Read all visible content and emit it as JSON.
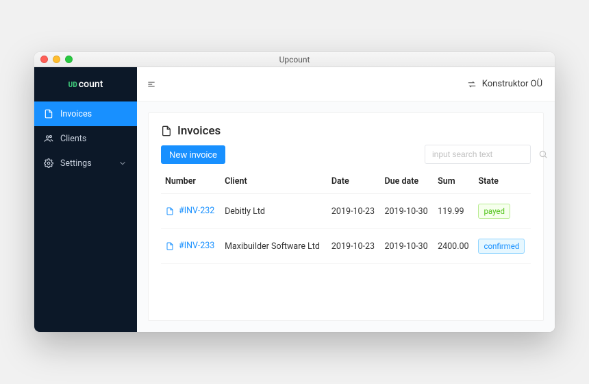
{
  "window": {
    "title": "Upcount"
  },
  "logo": {
    "prefix": "UD",
    "text": "count"
  },
  "sidebar": {
    "items": [
      {
        "key": "invoices",
        "label": "Invoices",
        "active": true,
        "icon": "file"
      },
      {
        "key": "clients",
        "label": "Clients",
        "active": false,
        "icon": "team"
      },
      {
        "key": "settings",
        "label": "Settings",
        "active": false,
        "icon": "gear",
        "chevron": true
      }
    ]
  },
  "topbar": {
    "org_label": "Konstruktor OÜ"
  },
  "page": {
    "title": "Invoices",
    "new_button": "New invoice",
    "search_placeholder": "input search text"
  },
  "table": {
    "columns": [
      "Number",
      "Client",
      "Date",
      "Due date",
      "Sum",
      "State"
    ],
    "rows": [
      {
        "number": "#INV-232",
        "client": "Debitly Ltd",
        "date": "2019-10-23",
        "due": "2019-10-30",
        "sum": "119.99",
        "state": "payed",
        "state_color": "green"
      },
      {
        "number": "#INV-233",
        "client": "Maxibuilder Software Ltd",
        "date": "2019-10-23",
        "due": "2019-10-30",
        "sum": "2400.00",
        "state": "confirmed",
        "state_color": "blue"
      }
    ]
  }
}
